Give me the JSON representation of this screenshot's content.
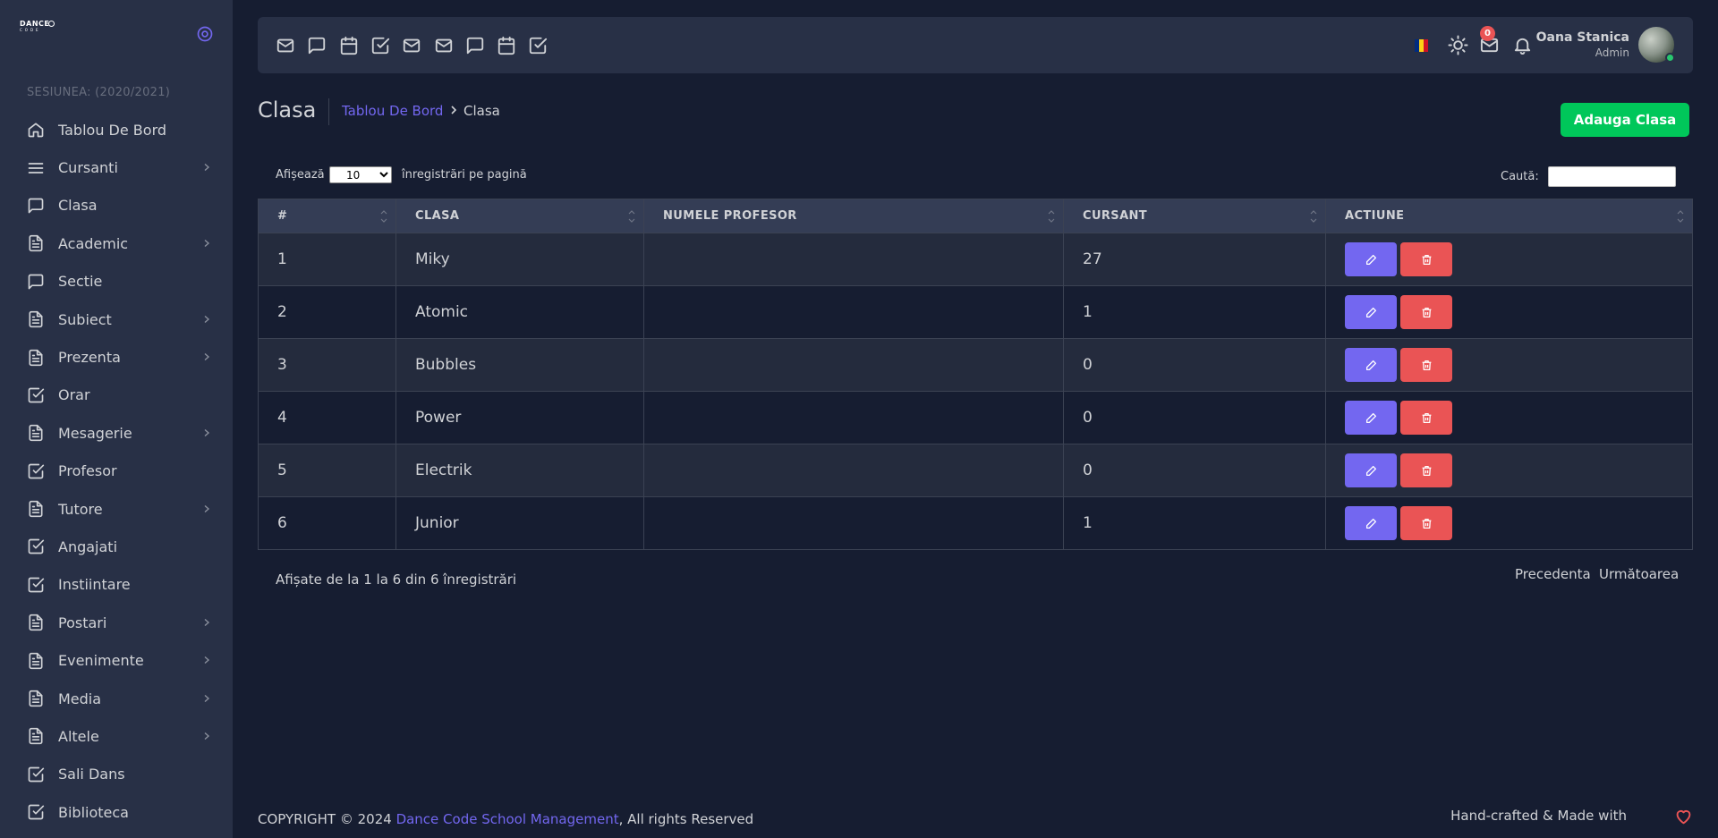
{
  "brand": {
    "line1": "DANCE",
    "line2": "CODE"
  },
  "sidebar": {
    "session": "SESIUNEA: (2020/2021)",
    "items": [
      {
        "label": "Tablou De Bord",
        "icon": "home-icon",
        "chevron": false
      },
      {
        "label": "Cursanti",
        "icon": "menu-icon",
        "chevron": true
      },
      {
        "label": "Clasa",
        "icon": "message-square-icon",
        "chevron": false
      },
      {
        "label": "Academic",
        "icon": "file-text-icon",
        "chevron": true
      },
      {
        "label": "Sectie",
        "icon": "message-square-icon",
        "chevron": false
      },
      {
        "label": "Subiect",
        "icon": "file-text-icon",
        "chevron": true
      },
      {
        "label": "Prezenta",
        "icon": "file-text-icon",
        "chevron": true
      },
      {
        "label": "Orar",
        "icon": "check-square-icon",
        "chevron": false
      },
      {
        "label": "Mesagerie",
        "icon": "file-text-icon",
        "chevron": true
      },
      {
        "label": "Profesor",
        "icon": "check-square-icon",
        "chevron": false
      },
      {
        "label": "Tutore",
        "icon": "file-text-icon",
        "chevron": true
      },
      {
        "label": "Angajati",
        "icon": "check-square-icon",
        "chevron": false
      },
      {
        "label": "Instiintare",
        "icon": "check-square-icon",
        "chevron": false
      },
      {
        "label": "Postari",
        "icon": "file-text-icon",
        "chevron": true
      },
      {
        "label": "Evenimente",
        "icon": "file-text-icon",
        "chevron": true
      },
      {
        "label": "Media",
        "icon": "file-text-icon",
        "chevron": true
      },
      {
        "label": "Altele",
        "icon": "file-text-icon",
        "chevron": true
      },
      {
        "label": "Sali Dans",
        "icon": "check-square-icon",
        "chevron": false
      },
      {
        "label": "Biblioteca",
        "icon": "check-square-icon",
        "chevron": false
      }
    ]
  },
  "navbar": {
    "bookmarks": [
      "mail-icon",
      "message-square-icon",
      "calendar-icon",
      "check-square-icon",
      "mail-icon",
      "mail-icon",
      "message-square-icon",
      "calendar-icon",
      "check-square-icon"
    ],
    "mail_badge": "0",
    "user_name": "Oana Stanica",
    "user_role": "Admin",
    "colors": {
      "accent": "#7367f0",
      "success": "#00c75a",
      "danger": "#ea5455"
    }
  },
  "page": {
    "title": "Clasa",
    "breadcrumb_link": "Tablou De Bord",
    "breadcrumb_current": "Clasa",
    "add_button": "Adauga Clasa"
  },
  "table_controls": {
    "show_label": "Afișează",
    "page_length": "10",
    "page_length_suffix": "înregistrări pe pagină",
    "search_label": "Caută:",
    "search_value": ""
  },
  "table": {
    "columns": [
      "#",
      "CLASA",
      "NUMELE PROFESOR",
      "CURSANT",
      "ACTIUNE"
    ],
    "rows": [
      {
        "num": "1",
        "clasa": "Miky",
        "profesor": "",
        "cursant": "27"
      },
      {
        "num": "2",
        "clasa": "Atomic",
        "profesor": "",
        "cursant": "1"
      },
      {
        "num": "3",
        "clasa": "Bubbles",
        "profesor": "",
        "cursant": "0"
      },
      {
        "num": "4",
        "clasa": "Power",
        "profesor": "",
        "cursant": "0"
      },
      {
        "num": "5",
        "clasa": "Electrik",
        "profesor": "",
        "cursant": "0"
      },
      {
        "num": "6",
        "clasa": "Junior",
        "profesor": "",
        "cursant": "1"
      }
    ]
  },
  "pagination": {
    "info": "Afișate de la 1 la 6 din 6 înregistrări",
    "prev": "Precedenta",
    "next": "Următoarea"
  },
  "footer": {
    "copyright_prefix": "COPYRIGHT © 2024 ",
    "brand_link": "Dance Code School Management",
    "copyright_suffix": ", All rights Reserved",
    "made_with": "Hand-crafted & Made with"
  }
}
